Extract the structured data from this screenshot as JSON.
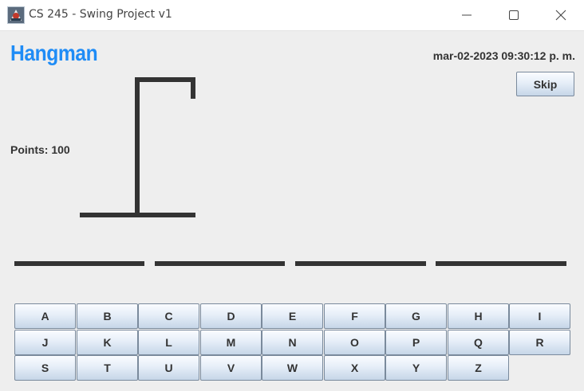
{
  "window": {
    "title": "CS 245 - Swing Project v1",
    "icon": "java-app-icon",
    "controls": [
      "minimize-icon",
      "maximize-icon",
      "close-icon"
    ]
  },
  "header": {
    "logo": "Hangman",
    "datetime": "mar-02-2023 09:30:12 p. m."
  },
  "skip_label": "Skip",
  "points_text": "Points: 100",
  "word": {
    "blank_count": 4
  },
  "keyboard": {
    "rows": [
      [
        "A",
        "B",
        "C",
        "D",
        "E",
        "F",
        "G",
        "H",
        "I"
      ],
      [
        "J",
        "K",
        "L",
        "M",
        "N",
        "O",
        "P",
        "Q",
        "R"
      ],
      [
        "S",
        "T",
        "U",
        "V",
        "W",
        "X",
        "Y",
        "Z"
      ]
    ]
  },
  "colors": {
    "logo": "#1f8cf6",
    "gallows": "#333333",
    "background": "#eeeeee"
  }
}
